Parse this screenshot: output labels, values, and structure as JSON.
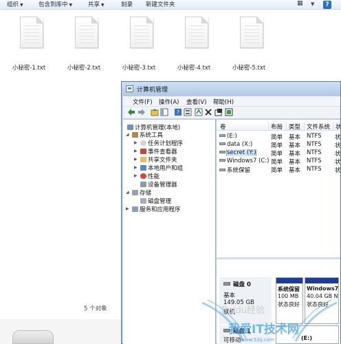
{
  "explorer": {
    "toolbar": {
      "organize": "组织",
      "include_in_library": "包含到库中",
      "share": "共享",
      "burn": "刻录",
      "new_folder": "新建文件夹"
    },
    "files": [
      {
        "name": "小秘密-1.txt"
      },
      {
        "name": "小秘密-2.txt"
      },
      {
        "name": "小秘密-3.txt"
      },
      {
        "name": "小秘密-4.txt"
      },
      {
        "name": "小秘密-5.txt"
      }
    ],
    "status": "5 个对象"
  },
  "computer_management": {
    "title": "计算机管理",
    "menu": [
      "文件(F)",
      "操作(A)",
      "查看(V)",
      "帮助(H)"
    ],
    "tree": {
      "root": "计算机管理(本地)",
      "system_tools": "系统工具",
      "task_scheduler": "任务计划程序",
      "event_viewer": "事件查看器",
      "shared_folders": "共享文件夹",
      "local_users": "本地用户和组",
      "performance": "性能",
      "device_manager": "设备管理器",
      "storage": "存储",
      "disk_management": "磁盘管理",
      "services_apps": "服务和应用程序"
    },
    "columns": [
      "卷",
      "布局",
      "类型",
      "文件系统",
      "状"
    ],
    "volumes": [
      {
        "name": "(E:)",
        "layout": "简单",
        "type": "基本",
        "fs": "NTFS",
        "status": "状"
      },
      {
        "name": "data (X:)",
        "layout": "简单",
        "type": "基本",
        "fs": "NTFS",
        "status": "状"
      },
      {
        "name": "secret (Y:)",
        "layout": "简单",
        "type": "基本",
        "fs": "NTFS",
        "status": "状"
      },
      {
        "name": "Windows7 (C:)",
        "layout": "简单",
        "type": "基本",
        "fs": "NTFS",
        "status": "状"
      },
      {
        "name": "系统保留",
        "layout": "简单",
        "type": "基本",
        "fs": "NTFS",
        "status": "状"
      }
    ],
    "disk0": {
      "label": "磁盘 0",
      "type": "基本",
      "size": "149.05 GB",
      "status": "联机",
      "partition1_name": "系统保留",
      "partition1_size": "100 MB",
      "partition1_status": "状态良好",
      "partition2_name": "Windows7",
      "partition2_size": "40.04 GB N",
      "partition2_status": "状态良好"
    },
    "disk1": {
      "label": "磁盘 1",
      "removable": "可移动",
      "volume": "(E:)"
    }
  },
  "watermark": {
    "baidu": "Baidu经验",
    "site": "我爱IT技术网",
    "url": "www.52ij.com"
  }
}
